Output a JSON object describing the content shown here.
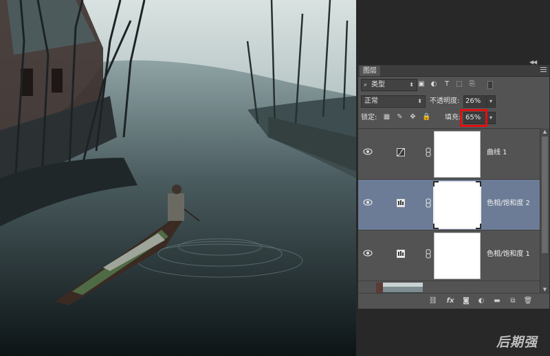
{
  "panel": {
    "tab_label": "图层",
    "filter_label": "类型",
    "blend_mode": "正常",
    "opacity_label": "不透明度:",
    "opacity_value": "26%",
    "lock_label": "锁定:",
    "fill_label": "填充:",
    "fill_value": "65%"
  },
  "layers": [
    {
      "name": "曲线 1",
      "type": "curves",
      "selected": false
    },
    {
      "name": "色相/饱和度 2",
      "type": "hue-saturation",
      "selected": true
    },
    {
      "name": "色相/饱和度 1",
      "type": "hue-saturation",
      "selected": false
    }
  ],
  "footer_icons": [
    "link-icon",
    "fx-icon",
    "mask-icon",
    "adjustment-icon",
    "folder-icon",
    "new-layer-icon",
    "trash-icon"
  ],
  "watermark": "后期强",
  "colors": {
    "panel_bg": "#535353",
    "selected_layer": "#6c7c96",
    "fill_highlight": "#e01010",
    "app_bg": "#282828"
  }
}
